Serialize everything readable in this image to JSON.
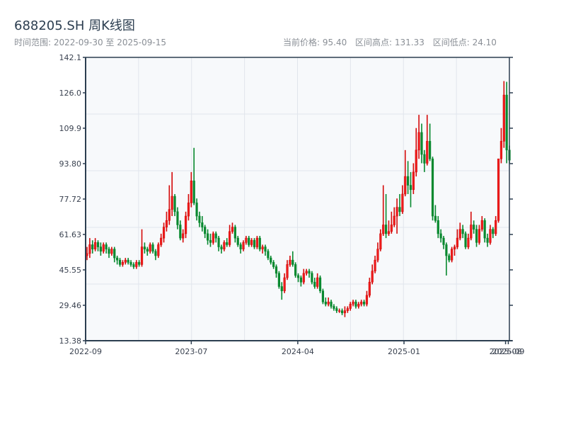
{
  "header": {
    "title": "688205.SH 周K线图",
    "range_label": "时间范围: 2022-09-30 至 2025-09-15",
    "current_price": "当前价格: 95.40",
    "period_high": "区间高点: 131.33",
    "period_low": "区间低点: 24.10"
  },
  "colors": {
    "up": "#d40a0a",
    "down": "#08892f",
    "axis": "#2c3e50",
    "grid": "#e1e5ec",
    "plot_bg": "#f7f9fb"
  },
  "chart_data": {
    "type": "candlestick",
    "title": "688205.SH 周K线图",
    "ylim": [
      13.38,
      142.1
    ],
    "yticks": [
      "13.38",
      "29.46",
      "45.55",
      "61.63",
      "77.72",
      "93.80",
      "109.9",
      "126.0",
      "142.1"
    ],
    "xticks": [
      {
        "index": 0,
        "label": "2022-09"
      },
      {
        "index": 38.5,
        "label": "2023-07"
      },
      {
        "index": 77.3,
        "label": "2024-04"
      },
      {
        "index": 116,
        "label": "2025-01"
      },
      {
        "index": 153,
        "label": "2025-08"
      },
      {
        "index": 154,
        "label": "2025-09"
      }
    ],
    "grid": true,
    "ohlc_format": [
      "open",
      "high",
      "low",
      "close"
    ],
    "ohlc": [
      [
        52,
        56,
        50,
        53
      ],
      [
        53,
        60,
        51,
        57
      ],
      [
        57,
        59,
        53,
        55
      ],
      [
        55,
        60,
        54,
        58
      ],
      [
        58,
        59,
        54,
        56
      ],
      [
        56,
        58,
        52,
        54
      ],
      [
        54,
        58,
        53,
        57
      ],
      [
        57,
        58,
        53,
        55
      ],
      [
        55,
        56,
        51,
        53
      ],
      [
        53,
        56,
        52,
        55
      ],
      [
        55,
        56,
        49,
        51
      ],
      [
        51,
        52,
        48,
        50
      ],
      [
        50,
        51,
        47,
        48
      ],
      [
        48,
        50,
        47,
        49
      ],
      [
        49,
        51,
        48,
        50
      ],
      [
        50,
        51,
        48,
        49
      ],
      [
        49,
        50,
        47,
        48
      ],
      [
        48,
        49,
        46,
        47
      ],
      [
        47,
        50,
        46,
        49
      ],
      [
        49,
        50,
        47,
        48
      ],
      [
        48,
        64,
        47,
        56
      ],
      [
        56,
        58,
        53,
        55
      ],
      [
        55,
        56,
        52,
        54
      ],
      [
        54,
        58,
        53,
        57
      ],
      [
        57,
        58,
        53,
        54
      ],
      [
        54,
        55,
        50,
        52
      ],
      [
        52,
        58,
        51,
        57
      ],
      [
        57,
        62,
        56,
        60
      ],
      [
        60,
        67,
        58,
        65
      ],
      [
        65,
        72,
        63,
        68
      ],
      [
        68,
        84,
        66,
        73
      ],
      [
        73,
        90,
        70,
        79
      ],
      [
        79,
        80,
        70,
        72
      ],
      [
        72,
        74,
        64,
        66
      ],
      [
        66,
        68,
        59,
        60
      ],
      [
        60,
        64,
        58,
        62
      ],
      [
        62,
        72,
        60,
        70
      ],
      [
        70,
        80,
        68,
        76
      ],
      [
        76,
        90,
        74,
        86
      ],
      [
        86,
        101,
        75,
        76
      ],
      [
        76,
        78,
        68,
        70
      ],
      [
        70,
        72,
        65,
        67
      ],
      [
        67,
        70,
        63,
        65
      ],
      [
        65,
        66,
        60,
        62
      ],
      [
        62,
        64,
        57,
        59
      ],
      [
        59,
        62,
        56,
        58
      ],
      [
        58,
        63,
        57,
        62
      ],
      [
        62,
        63,
        58,
        60
      ],
      [
        60,
        61,
        54,
        56
      ],
      [
        56,
        57,
        53,
        55
      ],
      [
        55,
        59,
        54,
        58
      ],
      [
        58,
        60,
        56,
        57
      ],
      [
        57,
        66,
        56,
        63
      ],
      [
        63,
        67,
        62,
        65
      ],
      [
        65,
        66,
        58,
        60
      ],
      [
        60,
        61,
        56,
        57
      ],
      [
        57,
        58,
        53,
        55
      ],
      [
        55,
        59,
        54,
        58
      ],
      [
        58,
        61,
        57,
        60
      ],
      [
        60,
        61,
        56,
        57
      ],
      [
        57,
        60,
        56,
        59
      ],
      [
        59,
        60,
        55,
        56
      ],
      [
        56,
        61,
        55,
        60
      ],
      [
        60,
        61,
        54,
        55
      ],
      [
        55,
        57,
        53,
        56
      ],
      [
        56,
        57,
        52,
        54
      ],
      [
        54,
        55,
        50,
        51
      ],
      [
        51,
        52,
        48,
        49
      ],
      [
        49,
        50,
        46,
        47
      ],
      [
        47,
        48,
        42,
        44
      ],
      [
        44,
        45,
        37,
        38
      ],
      [
        38,
        40,
        32,
        36
      ],
      [
        36,
        44,
        35,
        42
      ],
      [
        42,
        50,
        41,
        48
      ],
      [
        48,
        52,
        47,
        50
      ],
      [
        50,
        54,
        47,
        48
      ],
      [
        48,
        49,
        42,
        43
      ],
      [
        43,
        44,
        40,
        42
      ],
      [
        42,
        43,
        38,
        40
      ],
      [
        40,
        46,
        39,
        44
      ],
      [
        44,
        46,
        43,
        45
      ],
      [
        45,
        46,
        42,
        44
      ],
      [
        44,
        45,
        39,
        40
      ],
      [
        40,
        42,
        37,
        38
      ],
      [
        38,
        44,
        37,
        42
      ],
      [
        42,
        43,
        35,
        36
      ],
      [
        36,
        37,
        30,
        31
      ],
      [
        31,
        33,
        29,
        30
      ],
      [
        30,
        33,
        29,
        31
      ],
      [
        31,
        32,
        28,
        29
      ],
      [
        29,
        30,
        27,
        28
      ],
      [
        28,
        29,
        26,
        27
      ],
      [
        27,
        28,
        26,
        27
      ],
      [
        27,
        28,
        25,
        26
      ],
      [
        26,
        29,
        24.1,
        27
      ],
      [
        27,
        29,
        26,
        28
      ],
      [
        28,
        31,
        27,
        30
      ],
      [
        30,
        32,
        29,
        31
      ],
      [
        31,
        32,
        28,
        29
      ],
      [
        29,
        31,
        28,
        30
      ],
      [
        30,
        32,
        29,
        31
      ],
      [
        31,
        32,
        29,
        30
      ],
      [
        30,
        36,
        29,
        34
      ],
      [
        34,
        42,
        33,
        40
      ],
      [
        40,
        48,
        39,
        45
      ],
      [
        45,
        52,
        44,
        50
      ],
      [
        50,
        58,
        49,
        55
      ],
      [
        55,
        64,
        54,
        62
      ],
      [
        62,
        84,
        61,
        66
      ],
      [
        66,
        80,
        60,
        62
      ],
      [
        62,
        68,
        61,
        63
      ],
      [
        63,
        72,
        62,
        66
      ],
      [
        66,
        74,
        65,
        70
      ],
      [
        70,
        78,
        62,
        74
      ],
      [
        74,
        80,
        70,
        72
      ],
      [
        72,
        84,
        71,
        80
      ],
      [
        80,
        100,
        79,
        88
      ],
      [
        88,
        95,
        80,
        84
      ],
      [
        84,
        90,
        74,
        82
      ],
      [
        82,
        94,
        80,
        90
      ],
      [
        90,
        110,
        88,
        100
      ],
      [
        100,
        116,
        96,
        108
      ],
      [
        108,
        112,
        94,
        98
      ],
      [
        98,
        100,
        90,
        94
      ],
      [
        94,
        116,
        93,
        104
      ],
      [
        104,
        112,
        95,
        96
      ],
      [
        96,
        97,
        68,
        70
      ],
      [
        70,
        75,
        67,
        68
      ],
      [
        68,
        70,
        60,
        62
      ],
      [
        62,
        64,
        58,
        60
      ],
      [
        60,
        61,
        55,
        57
      ],
      [
        57,
        58,
        43,
        52
      ],
      [
        52,
        53,
        49,
        50
      ],
      [
        50,
        56,
        49,
        55
      ],
      [
        55,
        57,
        52,
        56
      ],
      [
        56,
        64,
        55,
        60
      ],
      [
        60,
        67,
        59,
        64
      ],
      [
        64,
        66,
        60,
        62
      ],
      [
        62,
        63,
        55,
        56
      ],
      [
        56,
        62,
        55,
        60
      ],
      [
        60,
        72,
        59,
        66
      ],
      [
        66,
        68,
        62,
        64
      ],
      [
        64,
        66,
        56,
        58
      ],
      [
        58,
        66,
        57,
        64
      ],
      [
        64,
        70,
        63,
        68
      ],
      [
        68,
        69,
        58,
        60
      ],
      [
        60,
        62,
        56,
        58
      ],
      [
        58,
        66,
        57,
        64
      ],
      [
        64,
        65,
        60,
        62
      ],
      [
        62,
        70,
        61,
        68
      ],
      [
        68,
        96,
        67,
        96
      ],
      [
        96,
        110,
        94,
        104
      ],
      [
        104,
        131.33,
        101,
        125
      ],
      [
        125,
        131,
        94,
        100
      ],
      [
        100,
        102,
        94,
        95.4
      ]
    ]
  }
}
